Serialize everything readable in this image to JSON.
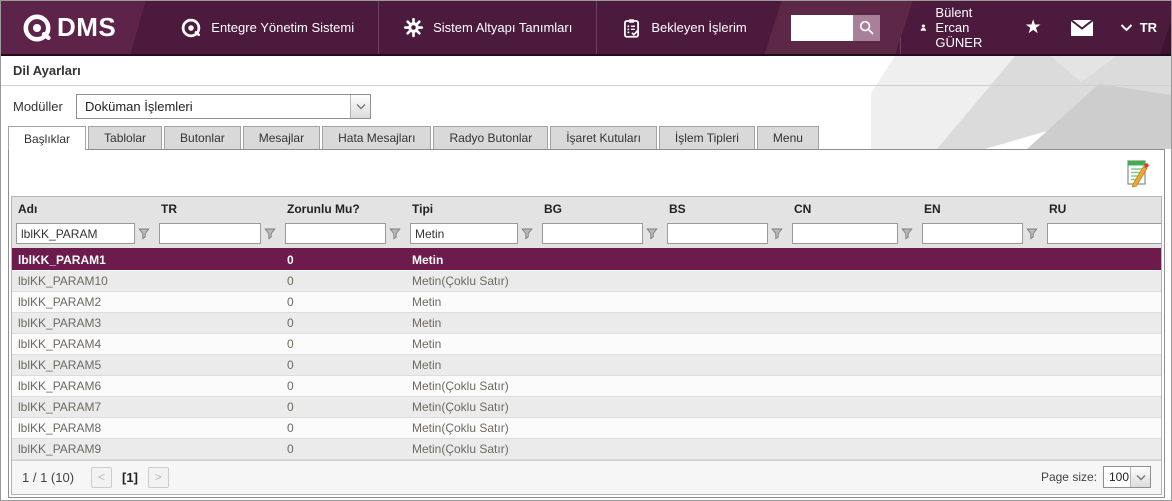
{
  "navbar": {
    "logo_text": "DMS",
    "menu": [
      {
        "label": "Entegre Yönetim Sistemi",
        "icon": "qdms-at-icon"
      },
      {
        "label": "Sistem Altyapı Tanımları",
        "icon": "gear-icon"
      },
      {
        "label": "Bekleyen İşlerim",
        "icon": "clipboard-check-icon"
      }
    ],
    "search": {
      "value": ""
    },
    "user": {
      "name": "Bülent Ercan GÜNER"
    },
    "language": {
      "code": "TR"
    }
  },
  "page": {
    "title": "Dil Ayarları"
  },
  "module_bar": {
    "label": "Modüller",
    "value": "Doküman İşlemleri"
  },
  "tabs": {
    "active": "Başlıklar",
    "items": [
      "Başlıklar",
      "Tablolar",
      "Butonlar",
      "Mesajlar",
      "Hata Mesajları",
      "Radyo Butonlar",
      "İşaret Kutuları",
      "İşlem Tipleri",
      "Menu"
    ]
  },
  "grid": {
    "columns": [
      "Adı",
      "TR",
      "Zorunlu Mu?",
      "Tipi",
      "BG",
      "BS",
      "CN",
      "EN",
      "RU"
    ],
    "filters": [
      "lblKK_PARAM",
      "",
      "",
      "Metin",
      "",
      "",
      "",
      "",
      ""
    ],
    "rows": [
      {
        "cells": [
          "lblKK_PARAM1",
          "",
          "0",
          "Metin",
          "",
          "",
          "",
          "",
          ""
        ],
        "selected": true
      },
      {
        "cells": [
          "lblKK_PARAM10",
          "",
          "0",
          "Metin(Çoklu Satır)",
          "",
          "",
          "",
          "",
          ""
        ],
        "selected": false
      },
      {
        "cells": [
          "lblKK_PARAM2",
          "",
          "0",
          "Metin",
          "",
          "",
          "",
          "",
          ""
        ],
        "selected": false
      },
      {
        "cells": [
          "lblKK_PARAM3",
          "",
          "0",
          "Metin",
          "",
          "",
          "",
          "",
          ""
        ],
        "selected": false
      },
      {
        "cells": [
          "lblKK_PARAM4",
          "",
          "0",
          "Metin",
          "",
          "",
          "",
          "",
          ""
        ],
        "selected": false
      },
      {
        "cells": [
          "lblKK_PARAM5",
          "",
          "0",
          "Metin",
          "",
          "",
          "",
          "",
          ""
        ],
        "selected": false
      },
      {
        "cells": [
          "lblKK_PARAM6",
          "",
          "0",
          "Metin(Çoklu Satır)",
          "",
          "",
          "",
          "",
          ""
        ],
        "selected": false
      },
      {
        "cells": [
          "lblKK_PARAM7",
          "",
          "0",
          "Metin(Çoklu Satır)",
          "",
          "",
          "",
          "",
          ""
        ],
        "selected": false
      },
      {
        "cells": [
          "lblKK_PARAM8",
          "",
          "0",
          "Metin(Çoklu Satır)",
          "",
          "",
          "",
          "",
          ""
        ],
        "selected": false
      },
      {
        "cells": [
          "lblKK_PARAM9",
          "",
          "0",
          "Metin(Çoklu Satır)",
          "",
          "",
          "",
          "",
          ""
        ],
        "selected": false
      }
    ]
  },
  "pagination": {
    "summary": "1 / 1 (10)",
    "prev": "<",
    "current": "[1]",
    "next": ">",
    "page_size_label": "Page size:",
    "page_size": "100"
  },
  "colors": {
    "navbar": "#4b1a3c",
    "navbar_light": "#5e2349",
    "navbar_dark": "#3d132e",
    "search_button": "#a8809a",
    "selected_row": "#6d1a4c"
  }
}
